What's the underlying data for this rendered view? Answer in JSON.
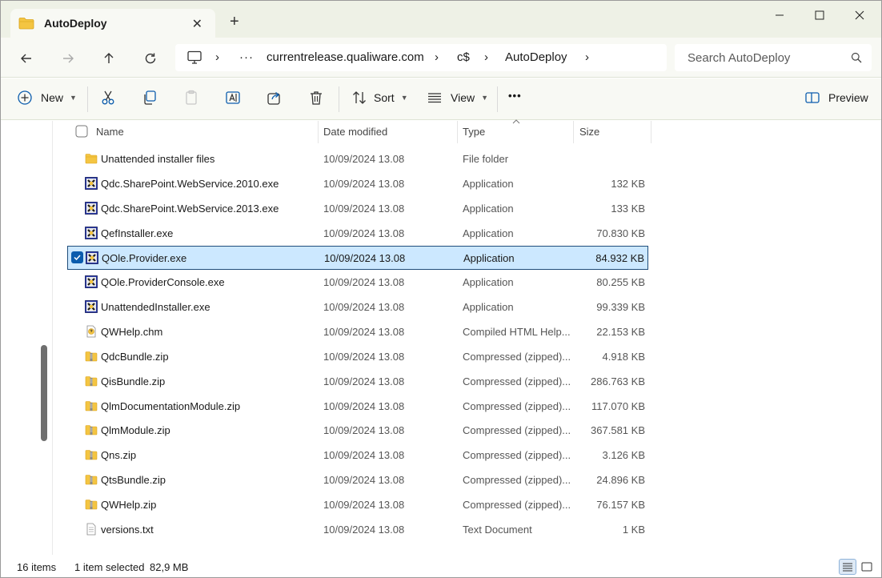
{
  "window": {
    "tab_title": "AutoDeploy",
    "close_tab": "✕",
    "new_tab": "+"
  },
  "nav": {
    "breadcrumb": [
      "currentrelease.qualiware.com",
      "c$",
      "AutoDeploy"
    ],
    "overflow": "···",
    "search_placeholder": "Search AutoDeploy"
  },
  "toolbar": {
    "new_label": "New",
    "sort_label": "Sort",
    "view_label": "View",
    "more_label": "•••",
    "preview_label": "Preview"
  },
  "columns": {
    "name": "Name",
    "date": "Date modified",
    "type": "Type",
    "size": "Size"
  },
  "files": [
    {
      "name": "Unattended installer files",
      "date": "10/09/2024 13.08",
      "type": "File folder",
      "size": "",
      "icon": "folder-icon"
    },
    {
      "name": "Qdc.SharePoint.WebService.2010.exe",
      "date": "10/09/2024 13.08",
      "type": "Application",
      "size": "132 KB",
      "icon": "application-icon"
    },
    {
      "name": "Qdc.SharePoint.WebService.2013.exe",
      "date": "10/09/2024 13.08",
      "type": "Application",
      "size": "133 KB",
      "icon": "application-icon"
    },
    {
      "name": "QefInstaller.exe",
      "date": "10/09/2024 13.08",
      "type": "Application",
      "size": "70.830 KB",
      "icon": "application-icon"
    },
    {
      "name": "QOle.Provider.exe",
      "date": "10/09/2024 13.08",
      "type": "Application",
      "size": "84.932 KB",
      "icon": "application-icon",
      "selected": true
    },
    {
      "name": "QOle.ProviderConsole.exe",
      "date": "10/09/2024 13.08",
      "type": "Application",
      "size": "80.255 KB",
      "icon": "application-icon"
    },
    {
      "name": "UnattendedInstaller.exe",
      "date": "10/09/2024 13.08",
      "type": "Application",
      "size": "99.339 KB",
      "icon": "application-icon"
    },
    {
      "name": "QWHelp.chm",
      "date": "10/09/2024 13.08",
      "type": "Compiled HTML Help...",
      "size": "22.153 KB",
      "icon": "chm-help-icon"
    },
    {
      "name": "QdcBundle.zip",
      "date": "10/09/2024 13.08",
      "type": "Compressed (zipped)...",
      "size": "4.918 KB",
      "icon": "zip-folder-icon"
    },
    {
      "name": "QisBundle.zip",
      "date": "10/09/2024 13.08",
      "type": "Compressed (zipped)...",
      "size": "286.763 KB",
      "icon": "zip-folder-icon"
    },
    {
      "name": "QlmDocumentationModule.zip",
      "date": "10/09/2024 13.08",
      "type": "Compressed (zipped)...",
      "size": "117.070 KB",
      "icon": "zip-folder-icon"
    },
    {
      "name": "QlmModule.zip",
      "date": "10/09/2024 13.08",
      "type": "Compressed (zipped)...",
      "size": "367.581 KB",
      "icon": "zip-folder-icon"
    },
    {
      "name": "Qns.zip",
      "date": "10/09/2024 13.08",
      "type": "Compressed (zipped)...",
      "size": "3.126 KB",
      "icon": "zip-folder-icon"
    },
    {
      "name": "QtsBundle.zip",
      "date": "10/09/2024 13.08",
      "type": "Compressed (zipped)...",
      "size": "24.896 KB",
      "icon": "zip-folder-icon"
    },
    {
      "name": "QWHelp.zip",
      "date": "10/09/2024 13.08",
      "type": "Compressed (zipped)...",
      "size": "76.157 KB",
      "icon": "zip-folder-icon"
    },
    {
      "name": "versions.txt",
      "date": "10/09/2024 13.08",
      "type": "Text Document",
      "size": "1 KB",
      "icon": "text-document-icon"
    }
  ],
  "status": {
    "item_count": "16 items",
    "selection": "1 item selected",
    "selection_size": "82,9 MB"
  },
  "colors": {
    "chrome_bg": "#eef1e6",
    "toolbar_bg": "#f8f9f4",
    "selection_bg": "#cce8ff",
    "selection_border": "#1f4d7a",
    "checkbox_accent": "#0b5cad",
    "folder_yellow": "#f4c542"
  }
}
